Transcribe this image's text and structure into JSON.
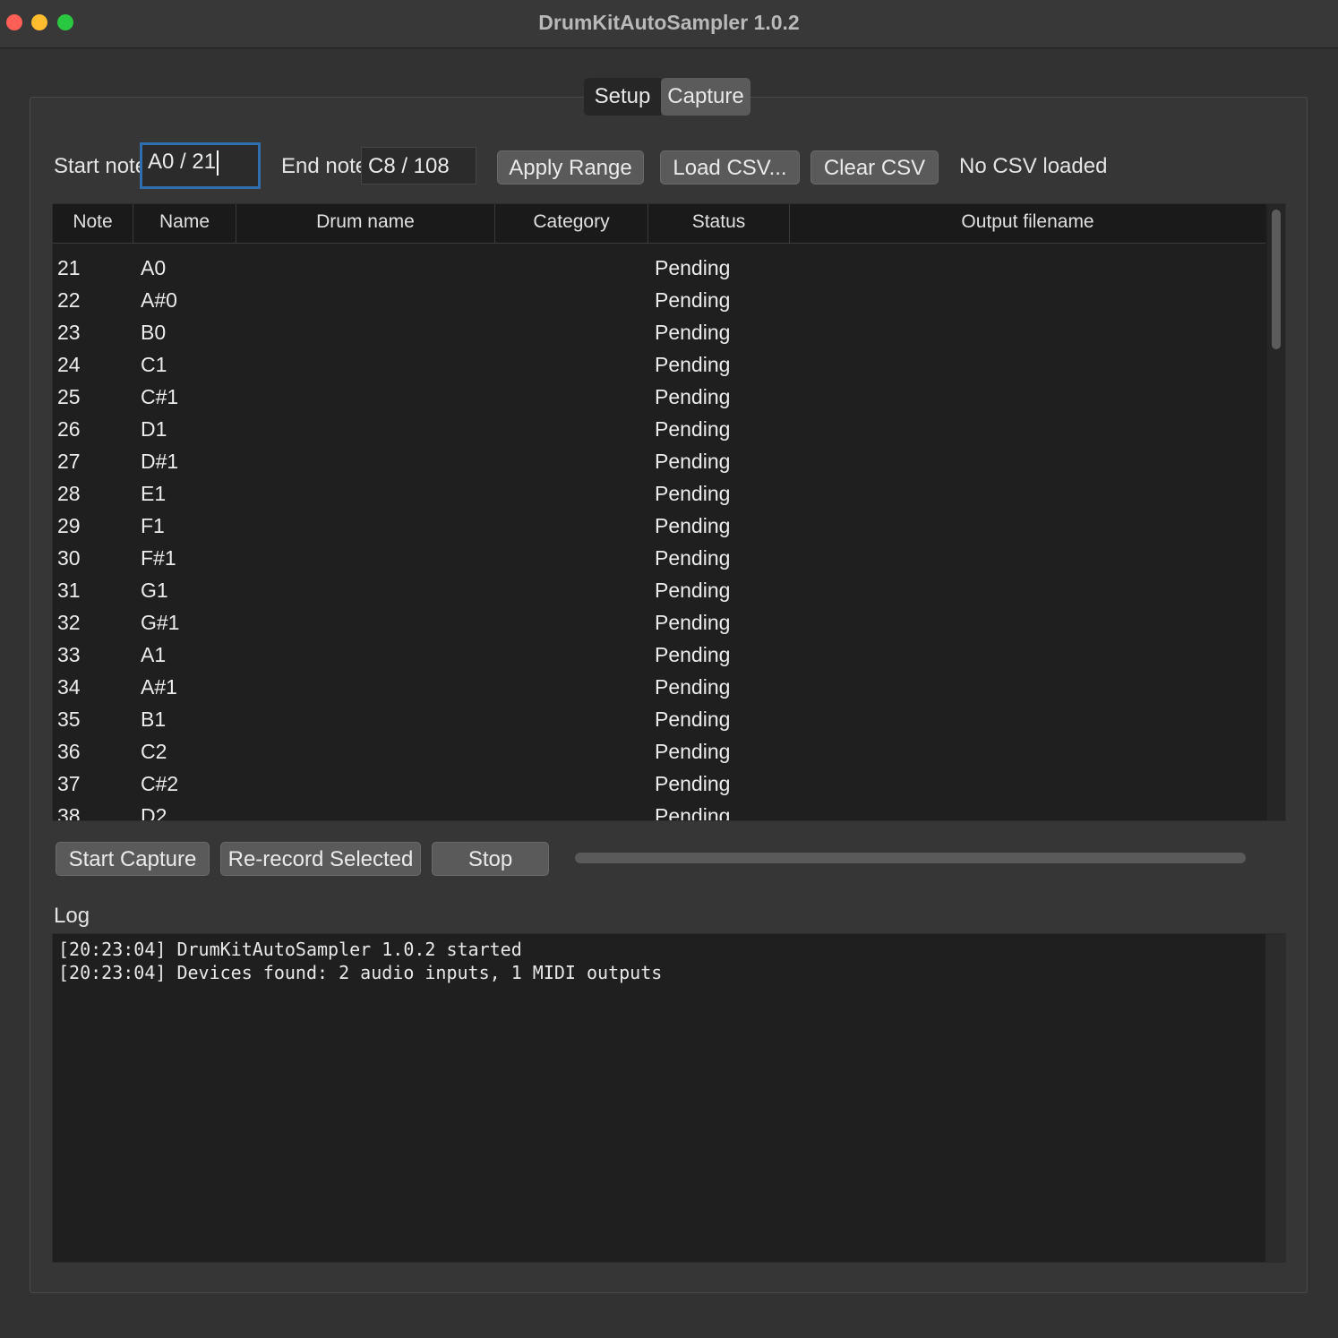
{
  "window": {
    "title": "DrumKitAutoSampler 1.0.2"
  },
  "tabs": [
    {
      "label": "Setup"
    },
    {
      "label": "Capture"
    }
  ],
  "range": {
    "start_label": "Start note",
    "start_value": "A0 / 21",
    "end_label": "End note",
    "end_value": "C8 / 108",
    "apply_label": "Apply Range",
    "load_csv_label": "Load CSV...",
    "clear_csv_label": "Clear CSV",
    "csv_status": "No CSV loaded"
  },
  "table": {
    "headers": [
      "Note",
      "Name",
      "Drum name",
      "Category",
      "Status",
      "Output filename"
    ],
    "rows": [
      {
        "note": "21",
        "name": "A0",
        "status": "Pending"
      },
      {
        "note": "22",
        "name": "A#0",
        "status": "Pending"
      },
      {
        "note": "23",
        "name": "B0",
        "status": "Pending"
      },
      {
        "note": "24",
        "name": "C1",
        "status": "Pending"
      },
      {
        "note": "25",
        "name": "C#1",
        "status": "Pending"
      },
      {
        "note": "26",
        "name": "D1",
        "status": "Pending"
      },
      {
        "note": "27",
        "name": "D#1",
        "status": "Pending"
      },
      {
        "note": "28",
        "name": "E1",
        "status": "Pending"
      },
      {
        "note": "29",
        "name": "F1",
        "status": "Pending"
      },
      {
        "note": "30",
        "name": "F#1",
        "status": "Pending"
      },
      {
        "note": "31",
        "name": "G1",
        "status": "Pending"
      },
      {
        "note": "32",
        "name": "G#1",
        "status": "Pending"
      },
      {
        "note": "33",
        "name": "A1",
        "status": "Pending"
      },
      {
        "note": "34",
        "name": "A#1",
        "status": "Pending"
      },
      {
        "note": "35",
        "name": "B1",
        "status": "Pending"
      },
      {
        "note": "36",
        "name": "C2",
        "status": "Pending"
      },
      {
        "note": "37",
        "name": "C#2",
        "status": "Pending"
      },
      {
        "note": "38",
        "name": "D2",
        "status": "Pending"
      }
    ]
  },
  "controls": {
    "start_capture_label": "Start Capture",
    "rerecord_label": "Re-record Selected",
    "stop_label": "Stop",
    "progress": 0
  },
  "log": {
    "label": "Log",
    "lines": [
      "[20:23:04] DrumKitAutoSampler 1.0.2 started",
      "[20:23:04] Devices found: 2 audio inputs, 1 MIDI outputs"
    ]
  }
}
